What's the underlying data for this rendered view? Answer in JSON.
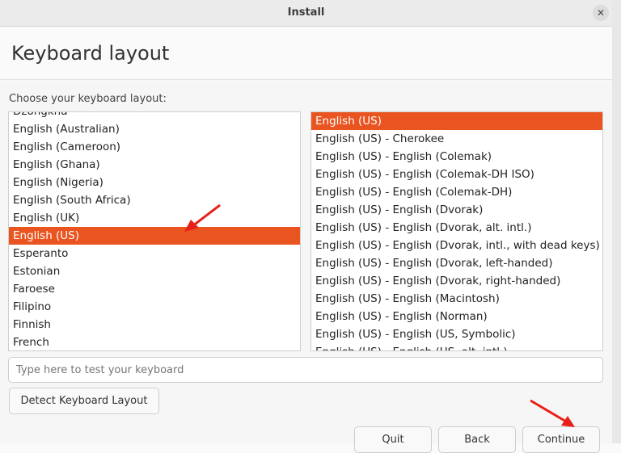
{
  "window": {
    "title": "Install",
    "close_icon": "close-icon"
  },
  "header": {
    "title": "Keyboard layout"
  },
  "main": {
    "choose_label": "Choose your keyboard layout:",
    "layouts": [
      "Dzongkha",
      "English (Australian)",
      "English (Cameroon)",
      "English (Ghana)",
      "English (Nigeria)",
      "English (South Africa)",
      "English (UK)",
      "English (US)",
      "Esperanto",
      "Estonian",
      "Faroese",
      "Filipino",
      "Finnish",
      "French"
    ],
    "selected_layout": "English (US)",
    "variants": [
      "English (US)",
      "English (US) - Cherokee",
      "English (US) - English (Colemak)",
      "English (US) - English (Colemak-DH ISO)",
      "English (US) - English (Colemak-DH)",
      "English (US) - English (Dvorak)",
      "English (US) - English (Dvorak, alt. intl.)",
      "English (US) - English (Dvorak, intl., with dead keys)",
      "English (US) - English (Dvorak, left-handed)",
      "English (US) - English (Dvorak, right-handed)",
      "English (US) - English (Macintosh)",
      "English (US) - English (Norman)",
      "English (US) - English (US, Symbolic)",
      "English (US) - English (US, alt. intl.)"
    ],
    "selected_variant": "English (US)",
    "test_placeholder": "Type here to test your keyboard",
    "detect_label": "Detect Keyboard Layout"
  },
  "footer": {
    "quit": "Quit",
    "back": "Back",
    "continue": "Continue"
  },
  "colors": {
    "accent": "#e95420",
    "annotation": "#e8201a"
  }
}
